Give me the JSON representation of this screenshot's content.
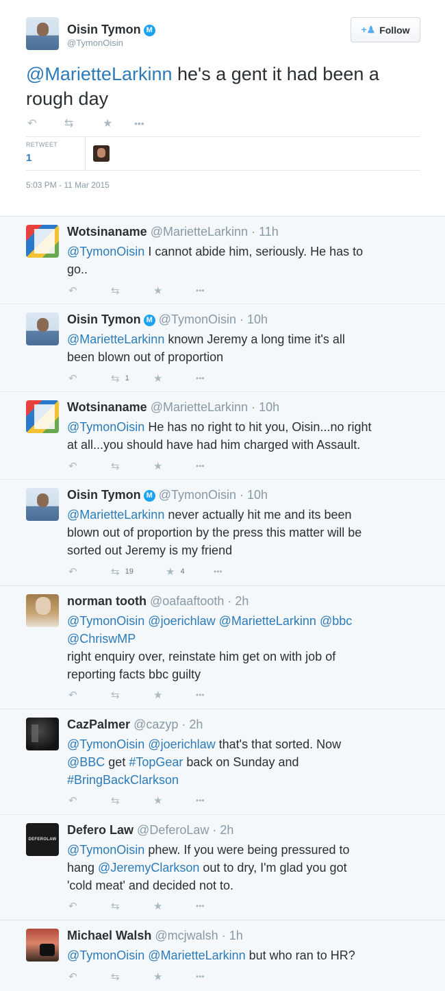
{
  "main": {
    "author": "Oisin Tymon",
    "verified_glyph": "M",
    "handle": "@TymonOisin",
    "follow_label": "Follow",
    "mention": "@MarietteLarkinn",
    "text": " he's a gent it had been a rough day",
    "retweet_label": "RETWEET",
    "retweet_count": "1",
    "timestamp": "5:03 PM - 11 Mar 2015"
  },
  "icons": {
    "reply": "reply-icon",
    "retweet": "retweet-icon",
    "favorite": "star-icon",
    "more": "more-icon"
  },
  "colors": {
    "link": "#2b7bb9",
    "verified": "#1da1f2",
    "muted": "#8899a6"
  },
  "replies": [
    {
      "name": "Wotsinaname",
      "handle": "@MarietteLarkinn",
      "time": "· 11h",
      "line1": "@TymonOisin",
      "line1_rest": " I cannot abide him, seriously. He has to",
      "line2": "go..",
      "line3": "",
      "retweets": "",
      "favorites": ""
    },
    {
      "name": "Oisin Tymon",
      "handle": "@TymonOisin",
      "time": "· 10h",
      "line1": "@MarietteLarkinn",
      "line1_rest": " known Jeremy a long time it's all",
      "line2": "been blown out of proportion",
      "line3": "",
      "retweets": "1",
      "favorites": ""
    },
    {
      "name": "Wotsinaname",
      "handle": "@MarietteLarkinn",
      "time": "· 10h",
      "line1": "@TymonOisin",
      "line1_rest": " He has no right to hit you, Oisin...no right",
      "line2": "at all...you should have had him charged with Assault.",
      "line3": "",
      "retweets": "",
      "favorites": ""
    },
    {
      "name": "Oisin Tymon",
      "handle": "@TymonOisin",
      "time": "· 10h",
      "line1": "@MarietteLarkinn",
      "line1_rest": " never actually hit me and its been",
      "line2": "blown out of proportion by the press this matter will be",
      "line3": "sorted out Jeremy is my friend",
      "retweets": "19",
      "favorites": "4"
    },
    {
      "name": "norman tooth",
      "handle": "@oafaaftooth",
      "time": "· 2h",
      "line1": "@TymonOisin @joerichlaw @MarietteLarkinn @bbc",
      "line1_rest": "",
      "line1b": "@ChriswMP",
      "line2": "right enquiry over, reinstate him get on with job of",
      "line3": "reporting facts bbc guilty",
      "retweets": "",
      "favorites": ""
    },
    {
      "name": "CazPalmer",
      "handle": "@cazyp",
      "time": "· 2h",
      "line1": "@TymonOisin @joerichlaw",
      "line1_rest": " that's that sorted. Now",
      "line2a": "@BBC",
      "line2b": " get ",
      "line2c": "#TopGear",
      "line2d": " back on Sunday and",
      "line3": "#BringBackClarkson",
      "retweets": "",
      "favorites": ""
    },
    {
      "name": "Defero Law",
      "handle": "@DeferoLaw",
      "time": "· 2h",
      "logo_text": "DEFEROLAW",
      "line1": "@TymonOisin",
      "line1_rest": " phew. If you were being pressured to",
      "line2a": "hang ",
      "line2b": "@JeremyClarkson",
      "line2c": " out to dry, I'm glad you got",
      "line3": "'cold meat' and decided not to.",
      "retweets": "",
      "favorites": ""
    },
    {
      "name": "Michael Walsh",
      "handle": "@mcjwalsh",
      "time": "· 1h",
      "line1": "@TymonOisin @MarietteLarkinn",
      "line1_rest": " but who ran to HR?",
      "line2": "",
      "line3": "",
      "retweets": "",
      "favorites": ""
    }
  ]
}
